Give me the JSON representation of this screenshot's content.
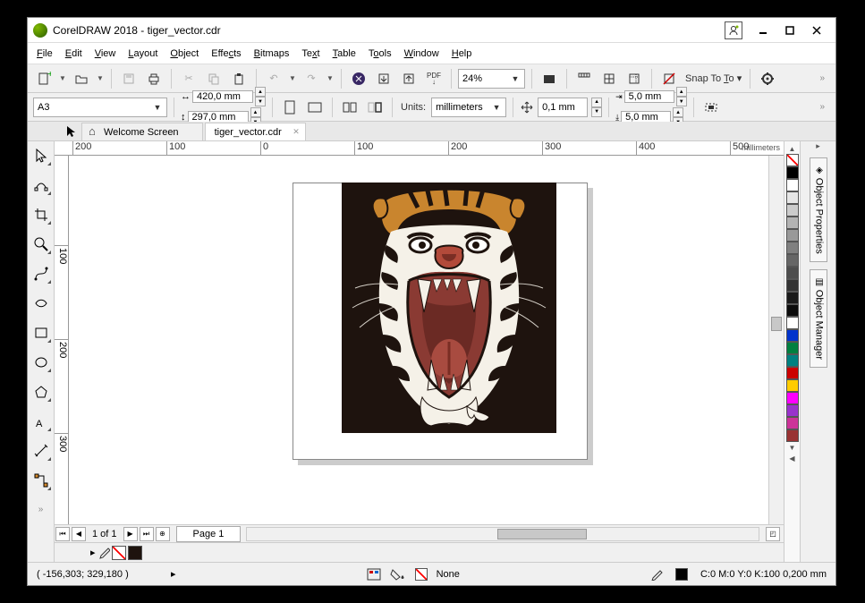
{
  "app": {
    "title": "CorelDRAW 2018 - tiger_vector.cdr"
  },
  "menu": [
    "File",
    "Edit",
    "View",
    "Layout",
    "Object",
    "Effects",
    "Bitmaps",
    "Text",
    "Table",
    "Tools",
    "Window",
    "Help"
  ],
  "toolbar1": {
    "zoom_value": "24%",
    "snap_label": "Snap To"
  },
  "toolbar2": {
    "page_preset": "A3",
    "width": "420,0 mm",
    "height": "297,0 mm",
    "units_label": "Units:",
    "units_value": "millimeters",
    "nudge": "0,1 mm",
    "dup_x": "5,0 mm",
    "dup_y": "5,0 mm"
  },
  "tabs": {
    "welcome": "Welcome Screen",
    "doc": "tiger_vector.cdr"
  },
  "ruler_unit": "millimeters",
  "ruler_h_ticks": [
    "200",
    "100",
    "0",
    "100",
    "200",
    "300",
    "400",
    "500"
  ],
  "ruler_v_ticks": [
    "100",
    "200",
    "300"
  ],
  "pagebar": {
    "counter": "1 of 1",
    "page_label": "Page 1"
  },
  "docks": {
    "props": "Object Properties",
    "mgr": "Object Manager"
  },
  "palette": [
    "#000000",
    "#ffffff",
    "#e6e6e6",
    "#cccccc",
    "#b3b3b3",
    "#999999",
    "#808080",
    "#666666",
    "#4d4d4d",
    "#333333",
    "#1a1a1a",
    "#0b0b0b",
    "#ffffff",
    "#0000ff",
    "#008000",
    "#008080",
    "#ff0000",
    "#ffff00",
    "#ff00ff",
    "#800080",
    "#c93b8c",
    "#a0522d",
    "#663399"
  ],
  "status": {
    "coords": "( -156,303; 329,180 )",
    "fill_label": "None",
    "outline": "C:0 M:0 Y:0 K:100  0,200 mm"
  }
}
